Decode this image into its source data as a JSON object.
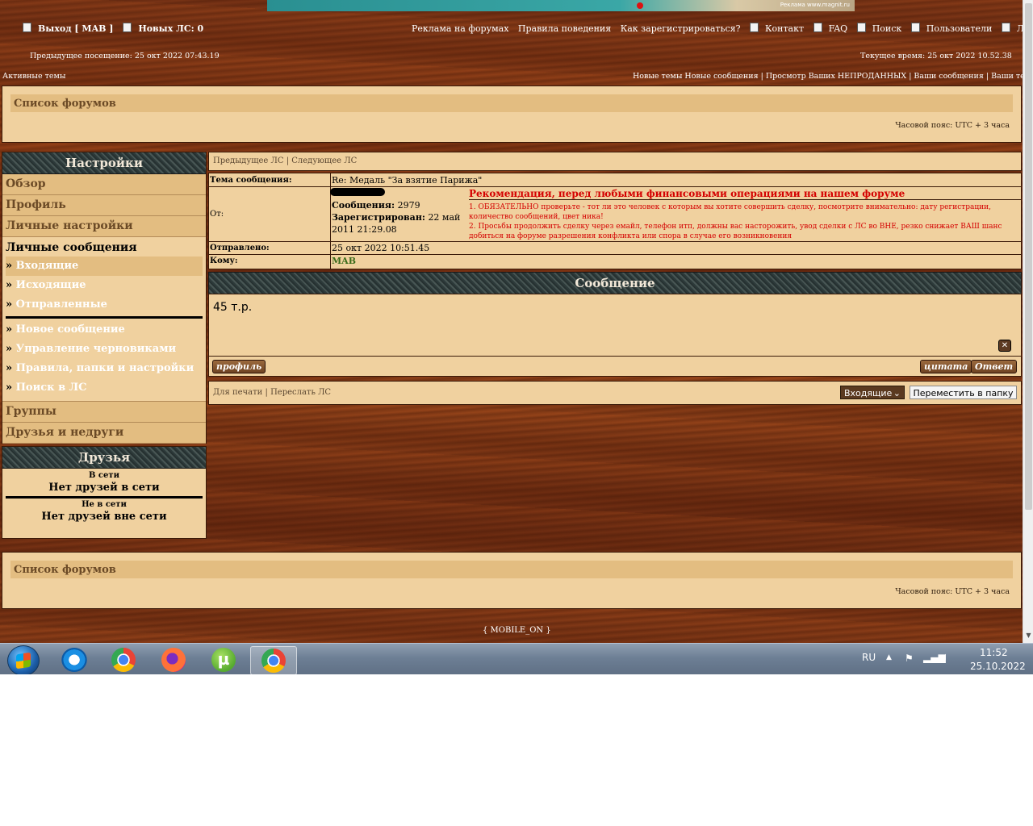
{
  "banner": {
    "text": "Реклама www.magnit.ru"
  },
  "header": {
    "logout": "Выход [ MAB ]",
    "new_pm": "Новых ЛС: 0",
    "links": [
      "Реклама на форумах",
      "Правила поведения",
      "Как зарегистрироваться?",
      "Контакт",
      "FAQ",
      "Поиск",
      "Пользователи",
      "Личный раздел"
    ],
    "prev_visit": "Предыдущее посещение: 25 окт 2022 07:43.19",
    "current_time": "Текущее время: 25 окт 2022 10.52.38",
    "active_topics": "Активные темы",
    "right_links": [
      "Новые темы",
      "Новые сообщения",
      "Просмотр Ваших НЕПРОДАННЫХ",
      "Ваши сообщения",
      "Ваши темы"
    ]
  },
  "top_panel": {
    "forum_list": "Список форумов",
    "timezone": "Часовой пояс: UTC + 3 часа"
  },
  "sidebar": {
    "settings_title": "Настройки",
    "items": [
      "Обзор",
      "Профиль",
      "Личные настройки"
    ],
    "pm_title": "Личные сообщения",
    "pm_links": [
      "Входящие",
      "Исходящие",
      "Отправленные"
    ],
    "pm_links2": [
      "Новое сообщение",
      "Управление черновиками",
      "Правила, папки и настройки",
      "Поиск в ЛС"
    ],
    "items_bottom": [
      "Группы",
      "Друзья и недруги"
    ],
    "friends_title": "Друзья",
    "online_label": "В сети",
    "online_empty": "Нет друзей в сети",
    "offline_label": "Не в сети",
    "offline_empty": "Нет друзей вне сети"
  },
  "message": {
    "nav_prev": "Предыдущее ЛС",
    "nav_next": "Следующее ЛС",
    "subject_label": "Тема сообщения:",
    "subject": "Re: Медаль \"За взятие Парижа\"",
    "from_label": "От:",
    "posts_label": "Сообщения:",
    "posts": "2979",
    "registered_label": "Зарегистрирован:",
    "registered": "22 май 2011 21:29.08",
    "warning_title": "Рекомендация, перед любыми финансовыми операциями на нашем форуме",
    "warning_1": "1. ОБЯЗАТЕЛЬНО проверьте - тот ли это человек с которым вы хотите совершить сделку, посмотрите внимательно: дату регистрации, количество сообщений, цвет ника!",
    "warning_2": "2. Просьбы продолжить сделку через емайл, телефон итп, должны вас насторожить, увод сделки с ЛС во ВНЕ, резко снижает ВАШ шанс добиться на форуме разрешения конфликта или спора в случае его возникновения",
    "sent_label": "Отправлено:",
    "sent": "25 окт 2022 10:51.45",
    "to_label": "Кому:",
    "to": "MAB",
    "to_color": "#3a6b1a",
    "body_title": "Сообщение",
    "body": "45 т.р.",
    "profile_btn": "профиль",
    "quote_btn": "цитата",
    "reply_btn": "Ответ"
  },
  "tools": {
    "print": "Для печати",
    "forward": "Переслать ЛС",
    "folder_select": "Входящие",
    "move_btn": "Переместить в папку"
  },
  "bottom_panel": {
    "forum_list": "Список форумов",
    "timezone": "Часовой пояс: UTC + 3 часа"
  },
  "footer": {
    "mobile": "{ MOBILE_ON }"
  },
  "taskbar": {
    "apps": [
      "ie-icon",
      "chrome-icon",
      "firefox-icon",
      "utorrent-icon",
      "chrome-profile-icon"
    ],
    "lang": "RU",
    "time": "11:52",
    "date": "25.10.2022"
  }
}
